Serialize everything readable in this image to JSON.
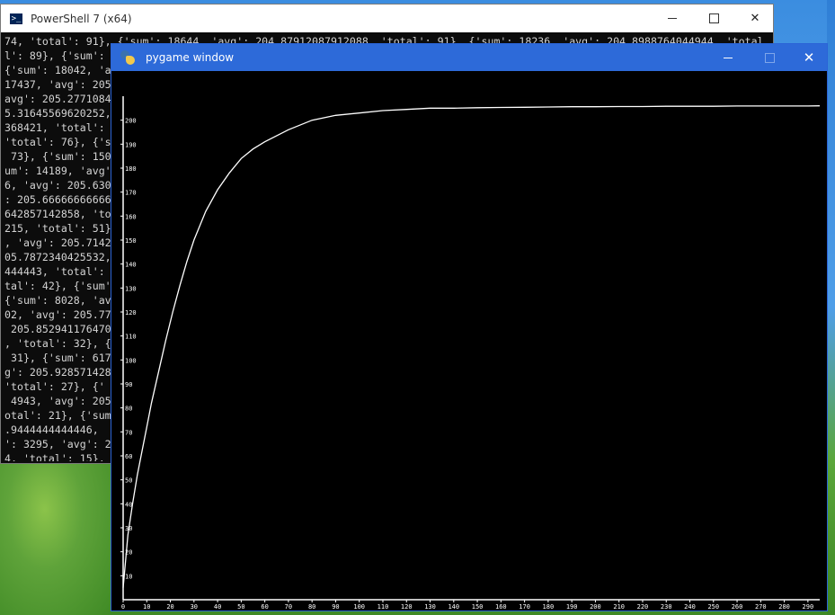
{
  "powershell": {
    "title": "PowerShell 7 (x64)",
    "lines": [
      "74, 'total': 91}, {'sum': 18644, 'avg': 204.87912087912088, 'total': 91}, {'sum': 18236, 'avg': 204.8988764044944, 'total",
      "l': 89}, {'sum':",
      "{'sum': 18042, 'a",
      "17437, 'avg': 205",
      "avg': 205.2771084",
      "5.31645569620252,",
      "368421, 'total':",
      "'total': 76}, {'s",
      " 73}, {'sum': 150",
      "um': 14189, 'avg'",
      "6, 'avg': 205.630",
      ": 205.66666666666",
      "642857142858, 'to",
      "215, 'total': 51}",
      ", 'avg': 205.7142",
      "05.7872340425532,",
      "444443, 'total':",
      "tal': 42}, {'sum'",
      "{'sum': 8028, 'av",
      "02, 'avg': 205.77",
      " 205.852941176470",
      ", 'total': 32}, {",
      " 31}, {'sum': 617",
      "g': 205.928571428",
      "'total': 27}, {'",
      " 4943, 'avg': 205",
      "otal': 21}, {'sum",
      ".9444444444446,",
      "': 3295, 'avg': 2",
      "4, 'total': 15},"
    ]
  },
  "pygame": {
    "title": "pygame window"
  },
  "chart_data": {
    "type": "line",
    "title": "",
    "xlabel": "",
    "ylabel": "",
    "xlim": [
      0,
      295
    ],
    "ylim": [
      0,
      210
    ],
    "x_ticks": [
      0,
      10,
      20,
      30,
      40,
      50,
      60,
      70,
      80,
      90,
      100,
      110,
      120,
      130,
      140,
      150,
      160,
      170,
      180,
      190,
      200,
      210,
      220,
      230,
      240,
      250,
      260,
      270,
      280,
      290
    ],
    "y_ticks": [
      10,
      20,
      30,
      40,
      50,
      60,
      70,
      80,
      90,
      100,
      110,
      120,
      130,
      140,
      150,
      160,
      170,
      180,
      190,
      200
    ],
    "grid": false,
    "line_color": "#ffffff",
    "series": [
      {
        "x": [
          0,
          2,
          4,
          6,
          8,
          10,
          12,
          15,
          18,
          21,
          24,
          27,
          30,
          35,
          40,
          45,
          50,
          55,
          60,
          70,
          80,
          90,
          100,
          110,
          120,
          130,
          140,
          150,
          160,
          170,
          180,
          190,
          200,
          210,
          220,
          230,
          240,
          250,
          260,
          270,
          280,
          290,
          295
        ],
        "y": [
          5,
          27,
          40,
          52,
          62,
          72,
          82,
          95,
          108,
          120,
          131,
          141,
          150,
          162,
          171,
          178,
          184,
          188,
          191,
          196,
          200,
          202,
          203,
          204,
          204.5,
          205,
          205,
          205.2,
          205.3,
          205.4,
          205.5,
          205.6,
          205.6,
          205.7,
          205.7,
          205.8,
          205.8,
          205.8,
          205.9,
          205.9,
          205.9,
          205.9,
          206
        ]
      }
    ]
  }
}
